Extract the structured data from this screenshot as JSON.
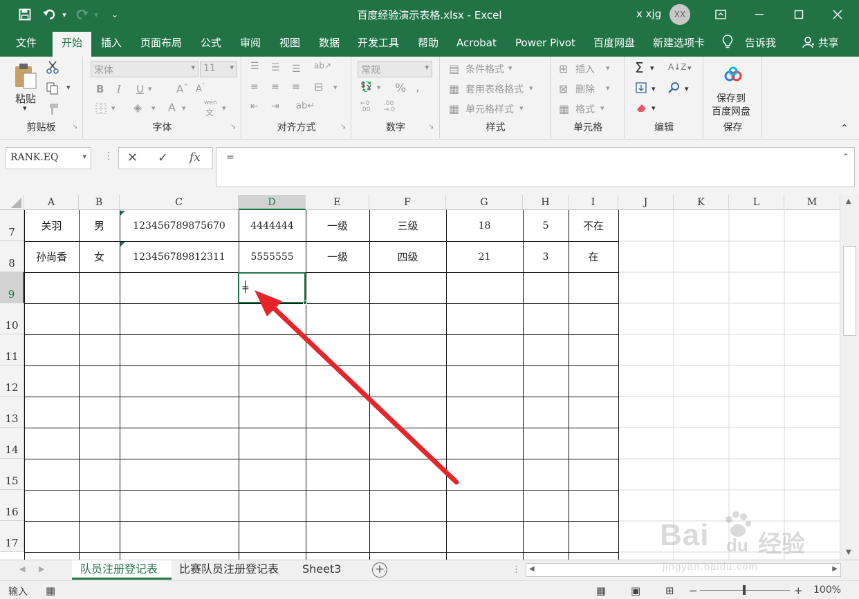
{
  "app": {
    "title": "百度经验演示表格.xlsx  -  Excel",
    "user": "x xjg",
    "avatar": "XX"
  },
  "tabs": [
    "文件",
    "开始",
    "插入",
    "页面布局",
    "公式",
    "审阅",
    "视图",
    "数据",
    "开发工具",
    "帮助",
    "Acrobat",
    "Power Pivot",
    "百度网盘",
    "新建选项卡",
    "告诉我",
    "共享"
  ],
  "ribbon": {
    "clipboard": {
      "label": "剪贴板",
      "paste": "粘贴"
    },
    "font": {
      "label": "字体",
      "name": "宋体",
      "size": "11",
      "phonetic": "wén"
    },
    "alignment": {
      "label": "对齐方式"
    },
    "number": {
      "label": "数字",
      "format": "常规"
    },
    "styles": {
      "label": "样式",
      "conditional": "条件格式",
      "table": "套用表格格式",
      "cell": "单元格样式"
    },
    "cells": {
      "label": "单元格",
      "insert": "插入",
      "delete": "删除",
      "format": "格式"
    },
    "editing": {
      "label": "编辑"
    },
    "save": {
      "label": "保存",
      "line1": "保存到",
      "line2": "百度网盘"
    }
  },
  "formula": {
    "namebox": "RANK.EQ",
    "content": "="
  },
  "columns": [
    "A",
    "B",
    "C",
    "D",
    "E",
    "F",
    "G",
    "H",
    "I",
    "J",
    "K",
    "L",
    "M"
  ],
  "rows": [
    {
      "num": "7",
      "cells": [
        "关羽",
        "男",
        "123456789875670",
        "4444444",
        "一级",
        "三级",
        "18",
        "5",
        "不在"
      ]
    },
    {
      "num": "8",
      "cells": [
        "孙尚香",
        "女",
        "123456789812311",
        "5555555",
        "一级",
        "四级",
        "21",
        "3",
        "在"
      ]
    },
    {
      "num": "9",
      "cells": [
        "",
        "",
        "",
        "=",
        "",
        "",
        "",
        "",
        ""
      ]
    },
    {
      "num": "10",
      "cells": [
        "",
        "",
        "",
        "",
        "",
        "",
        "",
        "",
        ""
      ]
    },
    {
      "num": "11",
      "cells": [
        "",
        "",
        "",
        "",
        "",
        "",
        "",
        "",
        ""
      ]
    },
    {
      "num": "12",
      "cells": [
        "",
        "",
        "",
        "",
        "",
        "",
        "",
        "",
        ""
      ]
    },
    {
      "num": "13",
      "cells": [
        "",
        "",
        "",
        "",
        "",
        "",
        "",
        "",
        ""
      ]
    },
    {
      "num": "14",
      "cells": [
        "",
        "",
        "",
        "",
        "",
        "",
        "",
        "",
        ""
      ]
    },
    {
      "num": "15",
      "cells": [
        "",
        "",
        "",
        "",
        "",
        "",
        "",
        "",
        ""
      ]
    },
    {
      "num": "16",
      "cells": [
        "",
        "",
        "",
        "",
        "",
        "",
        "",
        "",
        ""
      ]
    },
    {
      "num": "17",
      "cells": [
        "",
        "",
        "",
        "",
        "",
        "",
        "",
        "",
        ""
      ]
    }
  ],
  "sheets": [
    "队员注册登记表",
    "比赛队员注册登记表",
    "Sheet3"
  ],
  "status": {
    "mode": "输入",
    "zoom": "100%"
  },
  "watermark": {
    "brand": "Bai",
    "brand2": "du",
    "cn": "经验",
    "url": "jingyan.baidu.com"
  },
  "colors": {
    "accent": "#217346",
    "arrow": "#e8242b"
  }
}
